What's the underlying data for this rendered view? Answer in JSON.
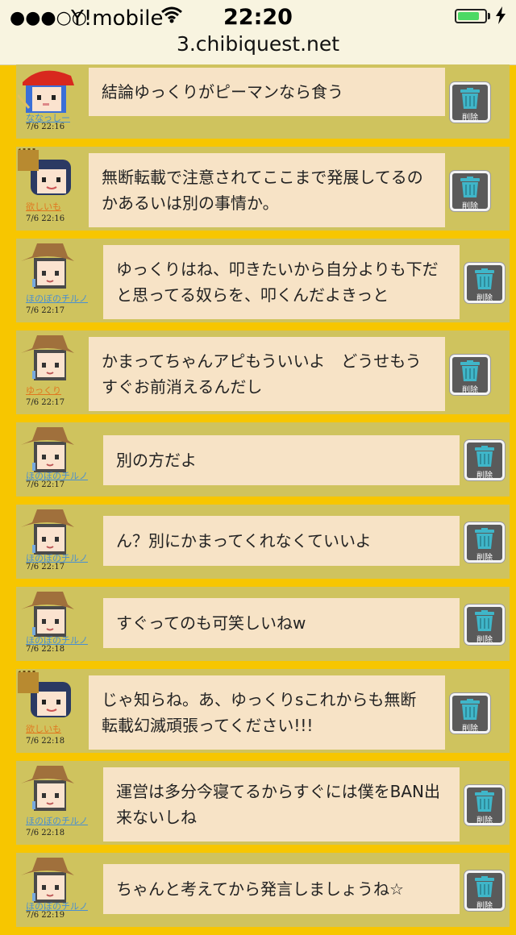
{
  "status_bar": {
    "signal": "●●●○○",
    "carrier": "Y!mobile",
    "wifi_icon": "wifi-icon",
    "time": "22:20",
    "battery_level": 0.8,
    "charging_icon": "bolt-icon",
    "url": "3.chibiquest.net"
  },
  "colors": {
    "page_bg": "#f7c600",
    "row_bg": "#cfc35e",
    "bubble_bg": "#f7e3c6",
    "delete_button_bg": "#5a5a5a",
    "trash_icon": "#3fb6c9",
    "user_name_blue": "#4a8fd0",
    "user_name_orange": "#e07820"
  },
  "delete_label": "削除",
  "posts": [
    {
      "user": "ななっしー",
      "user_color": "#4a8fd0",
      "avatar": "red-bandana-avatar",
      "time": "7/6 22:16",
      "text": "結論ゆっくりがピーマンなら食う"
    },
    {
      "user": "欲しいも",
      "user_color": "#e07820",
      "avatar": "crowned-avatar",
      "time": "7/6 22:16",
      "text": "無断転載で注意されてここまで発展してるのかあるいは別の事情か。"
    },
    {
      "user": "ほのぼのチルノ",
      "user_color": "#4a8fd0",
      "avatar": "cowboy-hat-avatar",
      "time": "7/6 22:17",
      "text": "ゆっくりはね、叩きたいから自分よりも下だと思ってる奴らを、叩くんだよきっと"
    },
    {
      "user": "ゆっくり",
      "user_color": "#e07820",
      "avatar": "cowboy-hat-avatar",
      "time": "7/6 22:17",
      "text": "かまってちゃんアピもういいよ　どうせもうすぐお前消えるんだし"
    },
    {
      "user": "ほのぼのチルノ",
      "user_color": "#4a8fd0",
      "avatar": "cowboy-hat-avatar",
      "time": "7/6 22:17",
      "text": "別の方だよ"
    },
    {
      "user": "ほのぼのチルノ",
      "user_color": "#4a8fd0",
      "avatar": "cowboy-hat-avatar",
      "time": "7/6 22:17",
      "text": "ん？別にかまってくれなくていいよ"
    },
    {
      "user": "ほのぼのチルノ",
      "user_color": "#4a8fd0",
      "avatar": "cowboy-hat-avatar",
      "time": "7/6 22:18",
      "text": "すぐってのも可笑しいねw"
    },
    {
      "user": "欲しいも",
      "user_color": "#e07820",
      "avatar": "crowned-avatar",
      "time": "7/6 22:18",
      "text": "じゃ知らね。あ、ゆっくりsこれからも無断転載幻滅頑張ってください!!!"
    },
    {
      "user": "ほのぼのチルノ",
      "user_color": "#4a8fd0",
      "avatar": "cowboy-hat-avatar",
      "time": "7/6 22:18",
      "text": "運営は多分今寝てるからすぐには僕をBAN出来ないしね"
    },
    {
      "user": "ほのぼのチルノ",
      "user_color": "#4a8fd0",
      "avatar": "cowboy-hat-avatar",
      "time": "7/6 22:19",
      "text": "ちゃんと考えてから発言しましょうね☆"
    }
  ]
}
